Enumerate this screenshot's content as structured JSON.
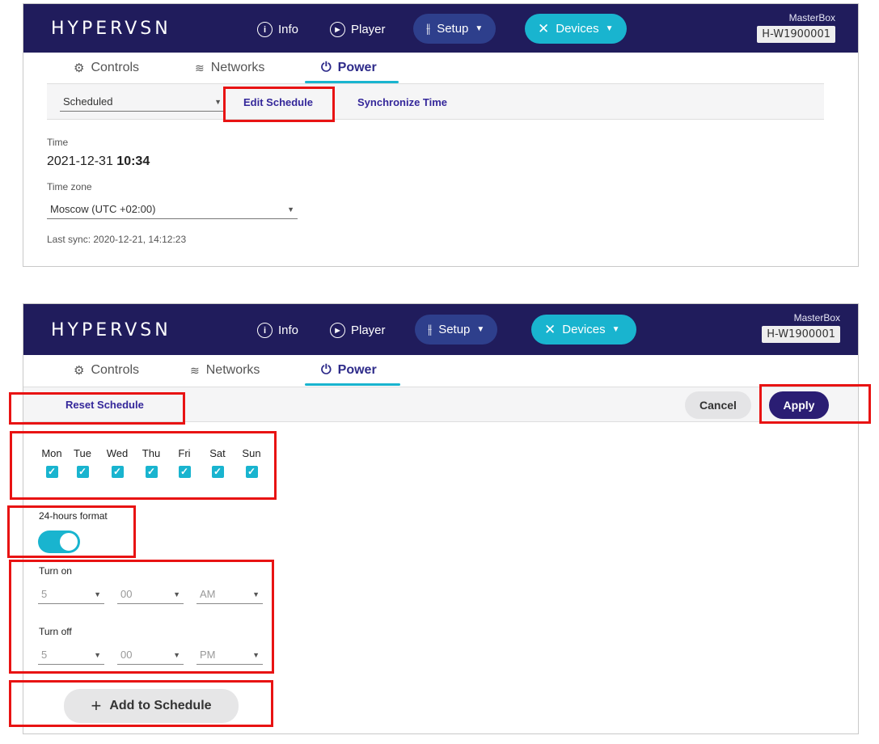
{
  "header": {
    "logo": "HYPERVSN",
    "nav_info": "Info",
    "nav_player": "Player",
    "nav_setup": "Setup",
    "nav_devices": "Devices",
    "masterbox_label": "MasterBox",
    "masterbox_id": "H-W1900001"
  },
  "tabs": {
    "controls": "Controls",
    "networks": "Networks",
    "power": "Power"
  },
  "panel1": {
    "mode_select": "Scheduled",
    "edit_schedule": "Edit Schedule",
    "synchronize_time": "Synchronize Time",
    "time_label": "Time",
    "time_date": "2021-12-31",
    "time_clock": "10:34",
    "timezone_label": "Time zone",
    "timezone_value": "Moscow (UTC +02:00)",
    "last_sync": "Last sync: 2020-12-21, 14:12:23"
  },
  "panel2": {
    "reset_schedule": "Reset Schedule",
    "cancel": "Cancel",
    "apply": "Apply",
    "days": [
      "Mon",
      "Tue",
      "Wed",
      "Thu",
      "Fri",
      "Sat",
      "Sun"
    ],
    "format_label": "24-hours format",
    "format_enabled": true,
    "turn_on_label": "Turn on",
    "turn_on_hour": "5",
    "turn_on_minute": "00",
    "turn_on_ampm": "AM",
    "turn_off_label": "Turn off",
    "turn_off_hour": "5",
    "turn_off_minute": "00",
    "turn_off_ampm": "PM",
    "add_to_schedule": "Add to Schedule"
  },
  "colors": {
    "header_bg": "#201c5c",
    "accent_cyan": "#19b4cf",
    "accent_purple": "#34279a",
    "highlight_red": "#e81313"
  }
}
